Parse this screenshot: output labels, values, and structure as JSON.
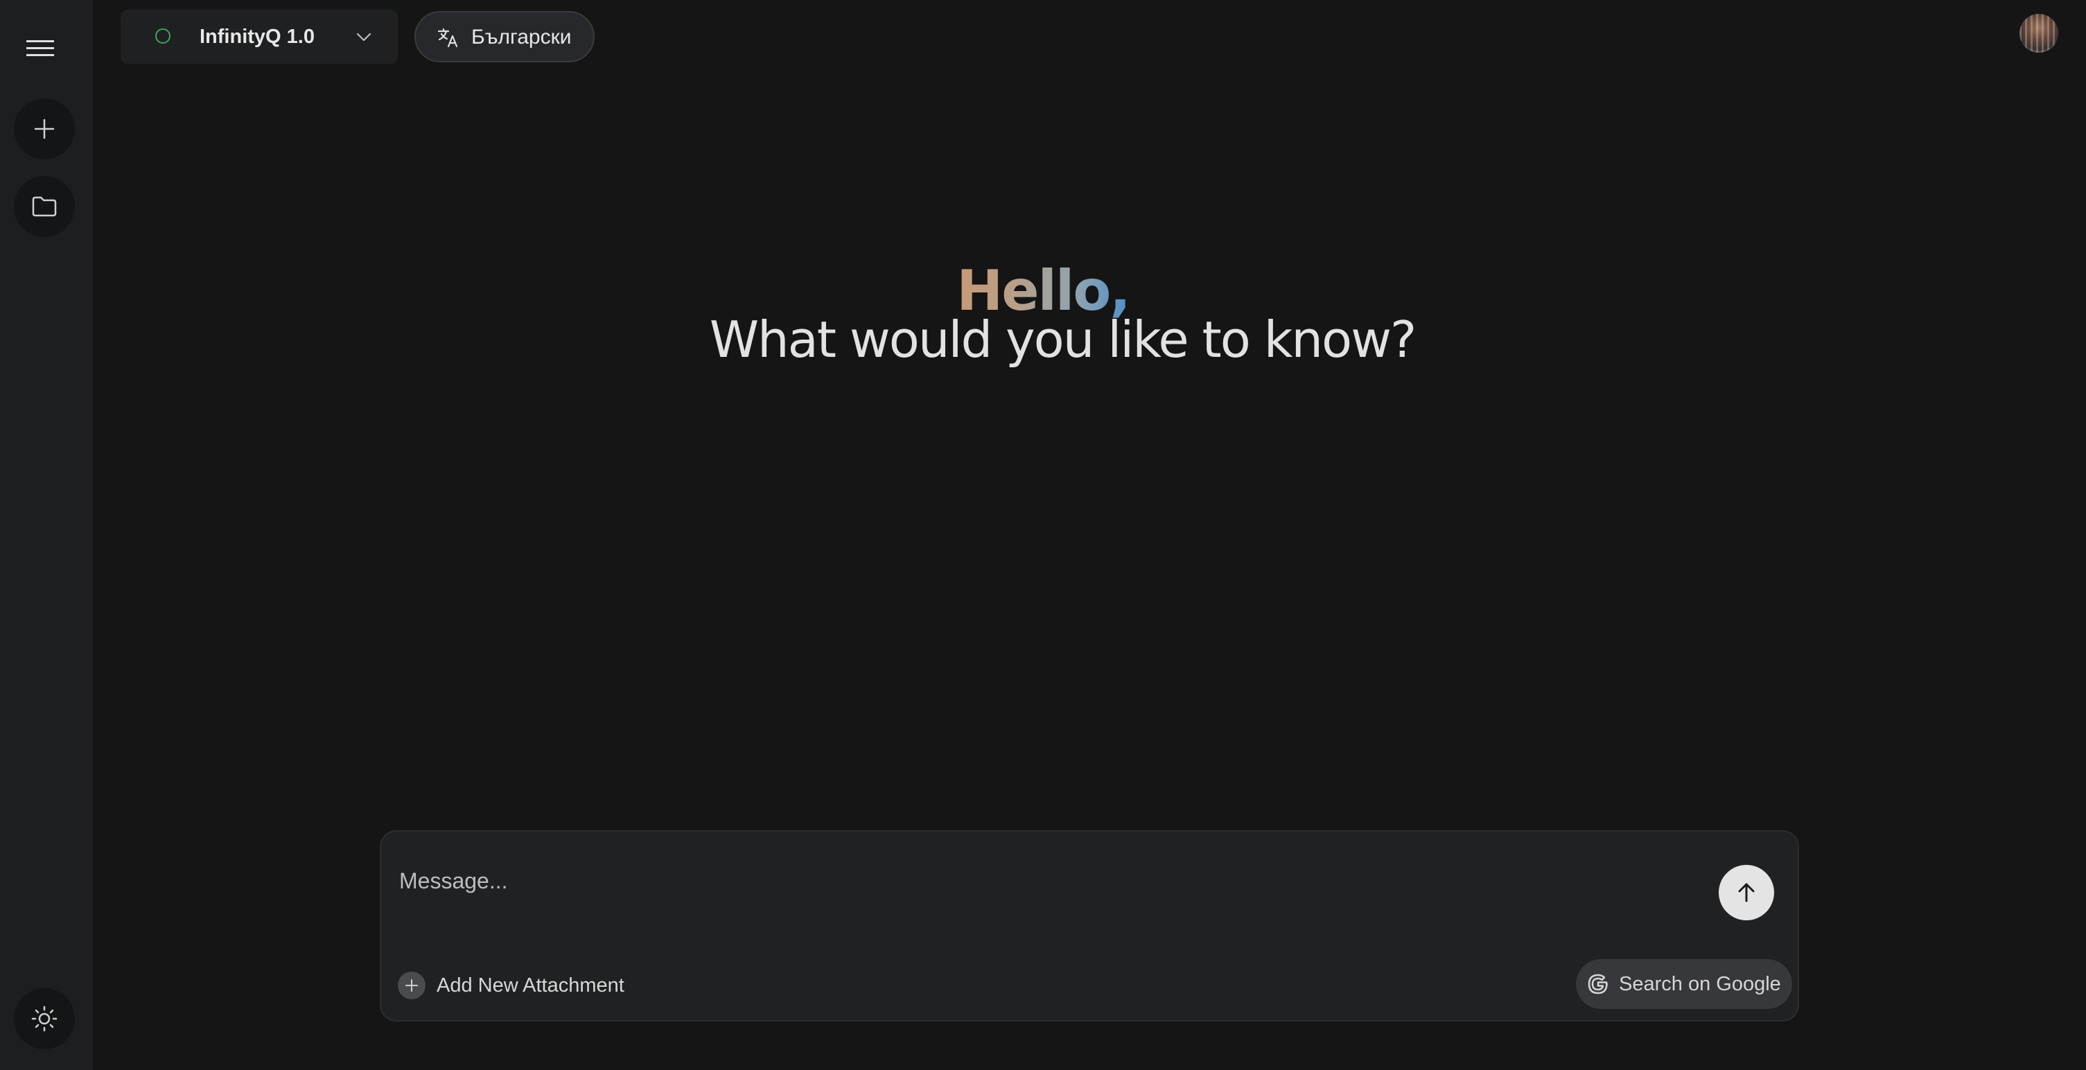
{
  "sidebar": {
    "menu_icon": "hamburger-menu-icon",
    "new_chat_icon": "plus-icon",
    "folder_icon": "folder-icon",
    "theme_icon": "sun-icon"
  },
  "header": {
    "model": {
      "label": "InfinityQ 1.0",
      "status_color": "#3fa35c",
      "chevron_icon": "chevron-down-icon"
    },
    "language": {
      "label": "Български",
      "icon": "translate-icon"
    },
    "avatar": "user-avatar"
  },
  "greeting": {
    "hello": "Hello,",
    "question": "What would you like to know?"
  },
  "composer": {
    "placeholder": "Message...",
    "value": "",
    "send_icon": "arrow-up-icon",
    "attach_label": "Add New Attachment",
    "attach_icon": "plus-circle-icon",
    "search_label": "Search on Google",
    "search_icon": "google-icon"
  },
  "colors": {
    "background": "#151516",
    "sidebar": "#1d1e20",
    "accent_green": "#3fa35c"
  }
}
